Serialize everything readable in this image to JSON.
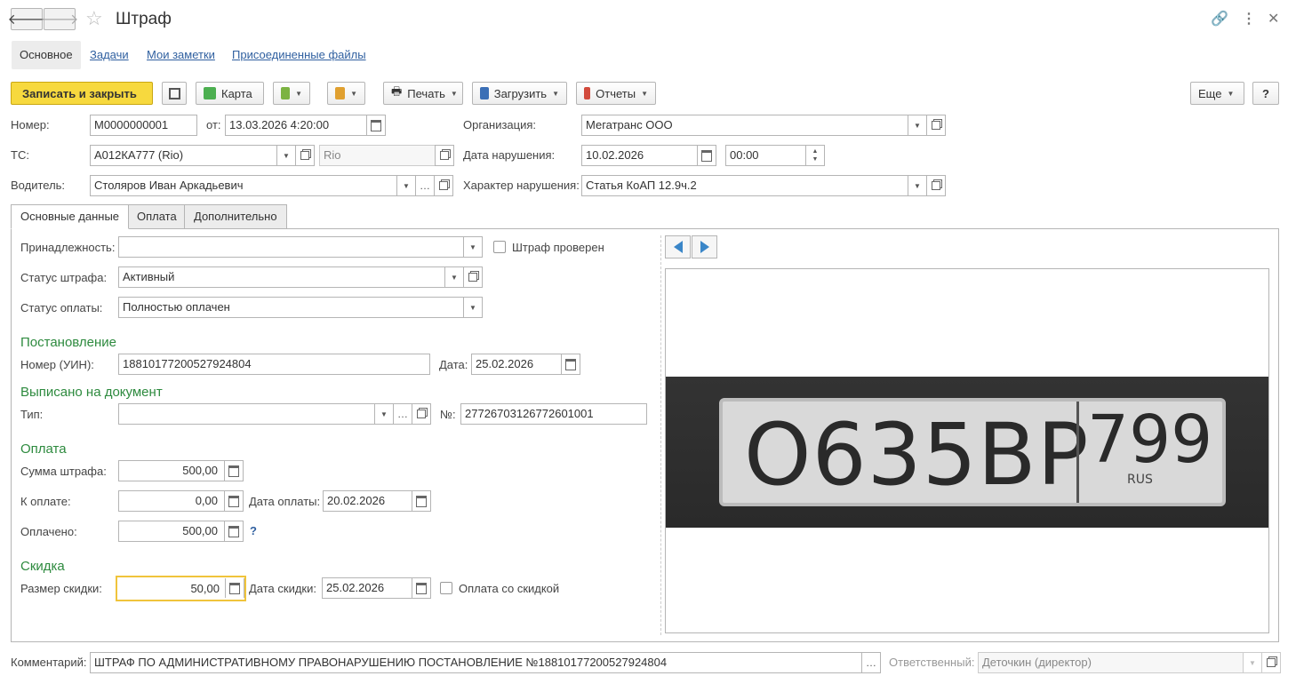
{
  "window": {
    "title": "Штраф"
  },
  "form_tabs": [
    "Основное",
    "Задачи",
    "Мои заметки",
    "Присоединенные файлы"
  ],
  "toolbar": {
    "save_close": "Записать и закрыть",
    "map": "Карта",
    "print": "Печать",
    "load": "Загрузить",
    "reports": "Отчеты",
    "more": "Еще",
    "help": "?"
  },
  "header": {
    "number_label": "Номер:",
    "number": "М0000000001",
    "from_label": "от:",
    "date": "13.03.2026  4:20:00",
    "org_label": "Организация:",
    "org": "Мегатранс ООО",
    "ts_label": "ТС:",
    "ts": "А012КА777 (Rio)",
    "ts_model": "Rio",
    "violation_date_label": "Дата нарушения:",
    "violation_date": "10.02.2026",
    "violation_time": "00:00",
    "driver_label": "Водитель:",
    "driver": "Столяров Иван Аркадьевич",
    "nature_label": "Характер нарушения:",
    "nature": "Статья КоАП 12.9ч.2"
  },
  "tabs": [
    "Основные данные",
    "Оплата",
    "Дополнительно"
  ],
  "main": {
    "belonging_label": "Принадлежность:",
    "belonging": "",
    "fine_checked_label": "Штраф проверен",
    "fine_status_label": "Статус штрафа:",
    "fine_status": "Активный",
    "pay_status_label": "Статус оплаты:",
    "pay_status": "Полностью оплачен",
    "sec_resolution": "Постановление",
    "uin_label": "Номер (УИН):",
    "uin": "18810177200527924804",
    "date_label": "Дата:",
    "resolution_date": "25.02.2026",
    "sec_issued": "Выписано на документ",
    "type_label": "Тип:",
    "type": "",
    "no_label": "№:",
    "doc_no": "27726703126772601001",
    "sec_payment": "Оплата",
    "fine_sum_label": "Сумма штрафа:",
    "fine_sum": "500,00",
    "to_pay_label": "К оплате:",
    "to_pay": "0,00",
    "pay_date_label": "Дата оплаты:",
    "pay_date": "20.02.2026",
    "paid_label": "Оплачено:",
    "paid": "500,00",
    "paid_help": "?",
    "sec_discount": "Скидка",
    "discount_label": "Размер скидки:",
    "discount": "50,00",
    "discount_date_label": "Дата скидки:",
    "discount_date": "25.02.2026",
    "discount_pay_label": "Оплата со скидкой"
  },
  "photo": {
    "plate_main": "О635ВР",
    "plate_region": "799",
    "plate_country": "RUS"
  },
  "footer": {
    "comment_label": "Комментарий:",
    "comment": "ШТРАФ ПО АДМИНИСТРАТИВНОМУ ПРАВОНАРУШЕНИЮ ПОСТАНОВЛЕНИЕ №18810177200527924804",
    "responsible_label": "Ответственный:",
    "responsible": "Деточкин (директор)"
  },
  "colors": {
    "accent": "#f7d93e",
    "section": "#2d8a3e",
    "link": "#3060a0"
  }
}
